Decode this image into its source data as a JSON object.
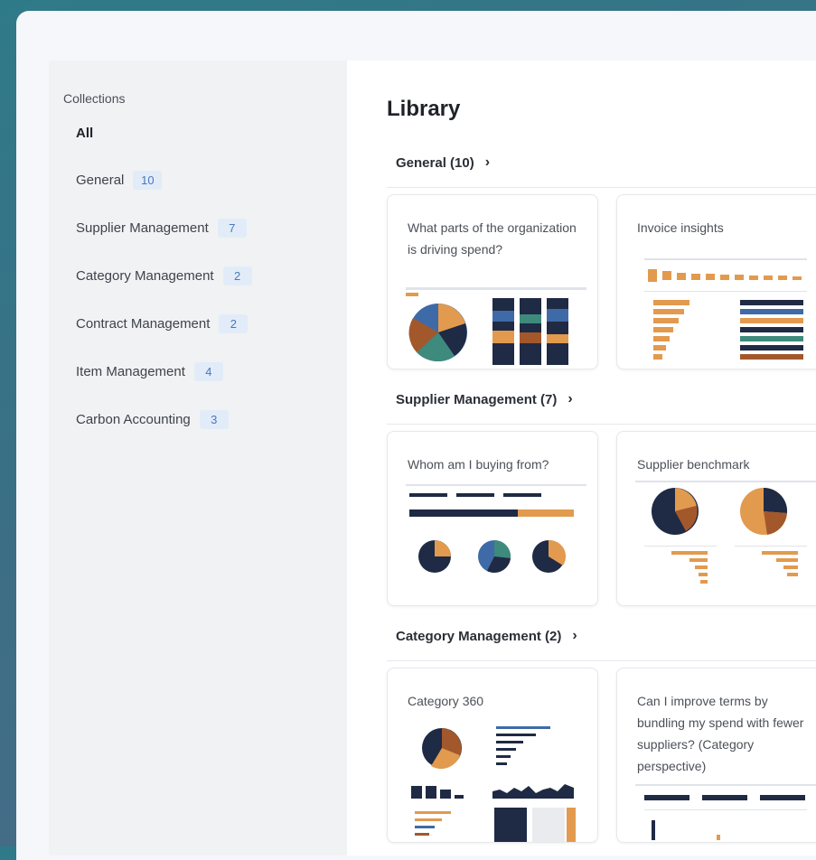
{
  "sidebar": {
    "title": "Collections",
    "items": [
      {
        "label": "All",
        "count": ""
      },
      {
        "label": "General",
        "count": "10"
      },
      {
        "label": "Supplier Management",
        "count": "7"
      },
      {
        "label": "Category Management",
        "count": "2"
      },
      {
        "label": "Contract Management",
        "count": "2"
      },
      {
        "label": "Item Management",
        "count": "4"
      },
      {
        "label": "Carbon Accounting",
        "count": "3"
      }
    ]
  },
  "main": {
    "title": "Library",
    "sections": [
      {
        "heading": "General (10)",
        "cards": [
          {
            "title": "What parts of the organization is driving spend?"
          },
          {
            "title": "Invoice insights"
          }
        ]
      },
      {
        "heading": "Supplier Management (7)",
        "cards": [
          {
            "title": "Whom am I buying from?"
          },
          {
            "title": "Supplier benchmark"
          }
        ]
      },
      {
        "heading": "Category Management (2)",
        "cards": [
          {
            "title": "Category 360"
          },
          {
            "title": "Can I improve terms by bundling my spend with fewer suppliers? (Category perspective)"
          }
        ]
      }
    ],
    "chevron_icon": "chevron-right-icon"
  },
  "colors": {
    "navy": "#1f2a44",
    "orange": "#e29a4e",
    "brown": "#a3582c",
    "teal": "#3e8a7c",
    "blue": "#3f6aa8",
    "badge_bg": "#e2ecf9",
    "badge_text": "#4a78b8"
  }
}
